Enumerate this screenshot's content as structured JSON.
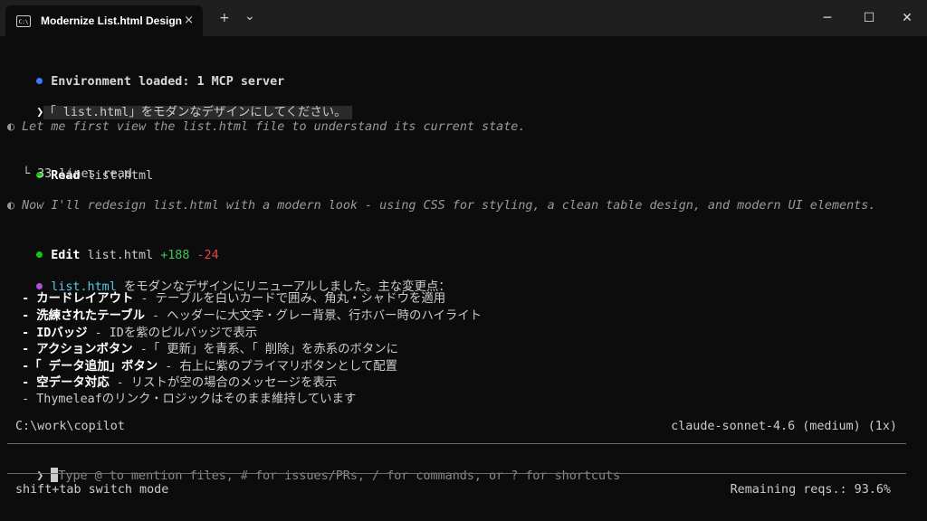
{
  "window": {
    "tab_title": "Modernize List.html Design",
    "tab_icon_text": "C:\\",
    "tab_close": "×",
    "new_tab": "+",
    "dropdown": "⌄",
    "minimize": "─",
    "maximize": "☐",
    "close": "✕"
  },
  "colors": {
    "info_dot": "#3b78ff",
    "ok_dot": "#16c60c",
    "bullet_prompt": "❯",
    "thought_dot": "#8a8a8a",
    "reply_dot": "#b04fcf"
  },
  "log": {
    "env": "Environment loaded: 1 MCP server",
    "prompt_mark": "❯",
    "user_msg": "「 list.html」をモダンなデザインにしてください。",
    "thought1": "◐ Let me first view the list.html file to understand its current state.",
    "read_label": "Read",
    "read_file": " list.html",
    "read_result": "└ 33 lines read",
    "thought2": "◐ Now I'll redesign list.html with a modern look - using CSS for styling, a clean table design, and modern UI elements.",
    "edit_label": "Edit",
    "edit_file": " list.html ",
    "edit_add": "+188",
    "edit_del": " -24",
    "reply_file": "list.html",
    "reply_text": " をモダンなデザインにリニューアルしました。主な変更点：",
    "changes": [
      {
        "head": "  - カードレイアウト",
        "body": " - テーブルを白いカードで囲み、角丸・シャドウを適用"
      },
      {
        "head": "  - 洗練されたテーブル",
        "body": " - ヘッダーに大文字・グレー背景、行ホバー時のハイライト"
      },
      {
        "head": "  - IDバッジ",
        "body": " - IDを紫のピルバッジで表示"
      },
      {
        "head": "  - アクションボタン",
        "body": " -「 更新」を青系、「 削除」を赤系のボタンに"
      },
      {
        "head": "  -「 データ追加」ボタン",
        "body": " - 右上に紫のプライマリボタンとして配置"
      },
      {
        "head": "  - 空データ対応",
        "body": " - リストが空の場合のメッセージを表示"
      },
      {
        "head": "",
        "body": "  - Thymeleafのリンク・ロジックはそのまま維持しています"
      }
    ]
  },
  "status": {
    "cwd": "C:\\work\\copilot",
    "model": "claude-sonnet-4.6 (medium) (1x)"
  },
  "input": {
    "prompt_mark": "❯",
    "placeholder": "Type @ to mention files, # for issues/PRs, / for commands, or ? for shortcuts"
  },
  "footer": {
    "mode_hint": "shift+tab switch mode",
    "remaining": "Remaining reqs.: 93.6%"
  }
}
